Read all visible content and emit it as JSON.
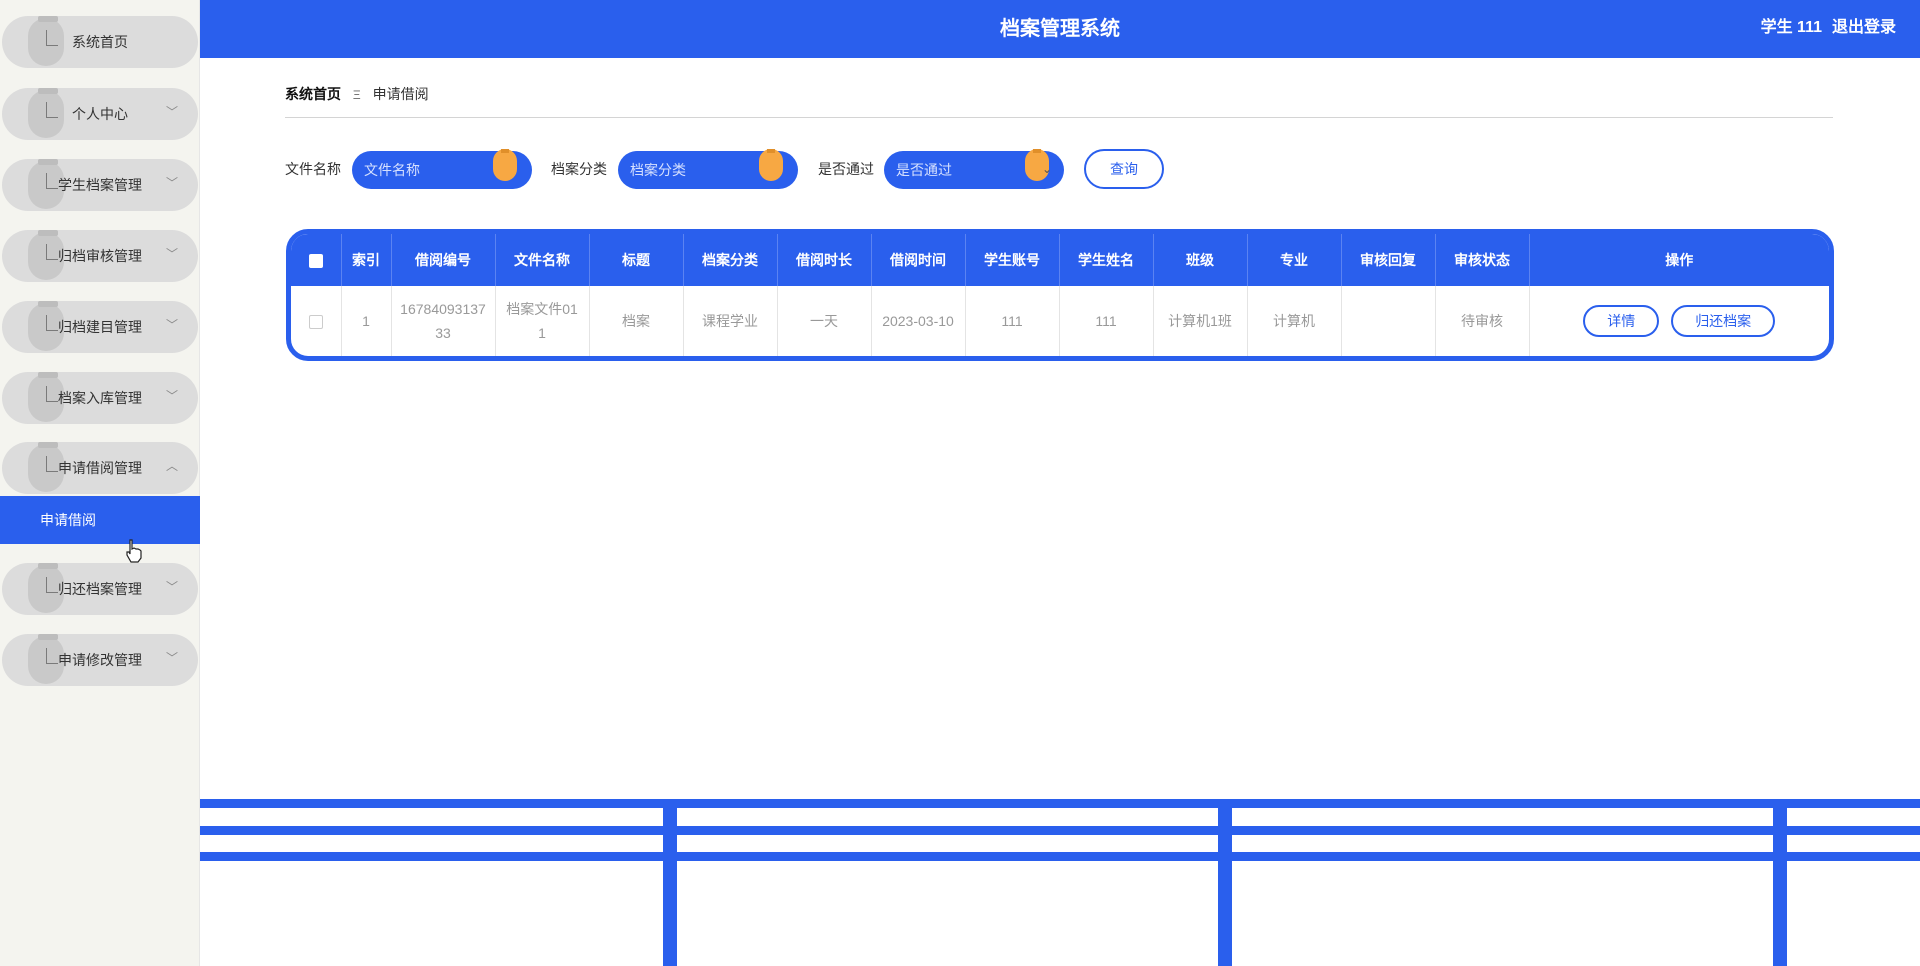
{
  "app": {
    "title": "档案管理系统",
    "user_label": "学生 111",
    "logout_label": "退出登录"
  },
  "sidebar": {
    "items": [
      {
        "label": "系统首页",
        "has_chevron": false
      },
      {
        "label": "个人中心",
        "has_chevron": true,
        "chevron": "﹀"
      },
      {
        "label": "学生档案管理",
        "has_chevron": true,
        "chevron": "﹀"
      },
      {
        "label": "归档审核管理",
        "has_chevron": true,
        "chevron": "﹀"
      },
      {
        "label": "归档建目管理",
        "has_chevron": true,
        "chevron": "﹀"
      },
      {
        "label": "档案入库管理",
        "has_chevron": true,
        "chevron": "﹀"
      },
      {
        "label": "申请借阅管理",
        "has_chevron": true,
        "chevron": "︿"
      },
      {
        "label": "归还档案管理",
        "has_chevron": true,
        "chevron": "﹀"
      },
      {
        "label": "申请修改管理",
        "has_chevron": true,
        "chevron": "﹀"
      }
    ],
    "active_sub_item": "申请借阅"
  },
  "breadcrumb": {
    "home": "系统首页",
    "separator": "Ξ",
    "current": "申请借阅"
  },
  "search": {
    "file_name_label": "文件名称",
    "file_name_placeholder": "文件名称",
    "category_label": "档案分类",
    "category_placeholder": "档案分类",
    "passed_label": "是否通过",
    "passed_placeholder": "是否通过",
    "query_label": "查询"
  },
  "table": {
    "headers": [
      "索引",
      "借阅编号",
      "文件名称",
      "标题",
      "档案分类",
      "借阅时长",
      "借阅时间",
      "学生账号",
      "学生姓名",
      "班级",
      "专业",
      "审核回复",
      "审核状态",
      "操作"
    ],
    "rows": [
      {
        "index": "1",
        "borrow_no": "1678409313733",
        "file_name": "档案文件011",
        "title": "档案",
        "category": "课程学业",
        "duration": "一天",
        "borrow_time": "2023-03-10",
        "student_account": "111",
        "student_name": "111",
        "class": "计算机1班",
        "major": "计算机",
        "review_reply": "",
        "review_status": "待审核",
        "detail_label": "详情",
        "return_label": "归还档案"
      }
    ]
  },
  "colors": {
    "primary": "#2a5fed",
    "knob": "#f7a843",
    "sidebar_bg": "#f4f4ef"
  }
}
